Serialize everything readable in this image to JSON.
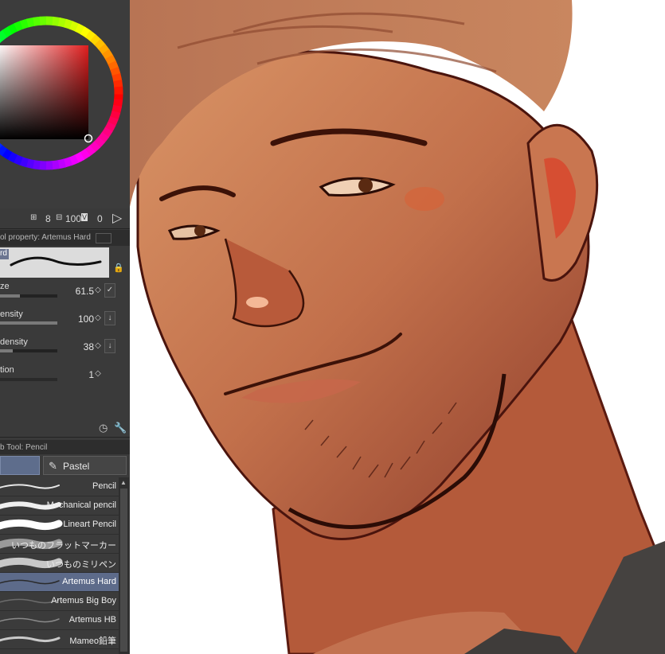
{
  "color": {
    "main_hex": "#d62a1e",
    "status": {
      "ic1": "⊞",
      "n1": "8",
      "ic2": "⊟",
      "n2": "100",
      "ic3": "V",
      "n3": "0",
      "play": "▷"
    }
  },
  "tool_property": {
    "title": "ol property: Artemus Hard",
    "brush_name": "rd",
    "lock": "🔒",
    "props": [
      {
        "label": "ze",
        "value": "61.5",
        "fill": 0.35,
        "btn": "✓"
      },
      {
        "label": "ensity",
        "value": "100",
        "fill": 1.0,
        "btn": "↓"
      },
      {
        "label": "density",
        "value": "38",
        "fill": 0.22,
        "btn": "↓"
      },
      {
        "label": "tion",
        "value": "1",
        "fill": 0.0
      }
    ],
    "spin": "◇"
  },
  "footer_icons": {
    "adjust": "◷",
    "settings": "🔧"
  },
  "sub_tool": {
    "title": "b Tool: Pencil",
    "tab_pastel": "Pastel",
    "pastel_icon": "✎",
    "scroll_up": "▲",
    "brushes": [
      {
        "name": "Pencil",
        "selected": false
      },
      {
        "name": "Mechanical pencil",
        "selected": false
      },
      {
        "name": "Lineart Pencil",
        "selected": false
      },
      {
        "name": "いつものフラットマーカー",
        "selected": false
      },
      {
        "name": "いつものミリペン",
        "selected": false
      },
      {
        "name": "Artemus Hard",
        "selected": true
      },
      {
        "name": "Artemus Big Boy",
        "selected": false
      },
      {
        "name": "Artemus HB",
        "selected": false
      },
      {
        "name": "Mameo鉛筆",
        "selected": false
      }
    ]
  }
}
